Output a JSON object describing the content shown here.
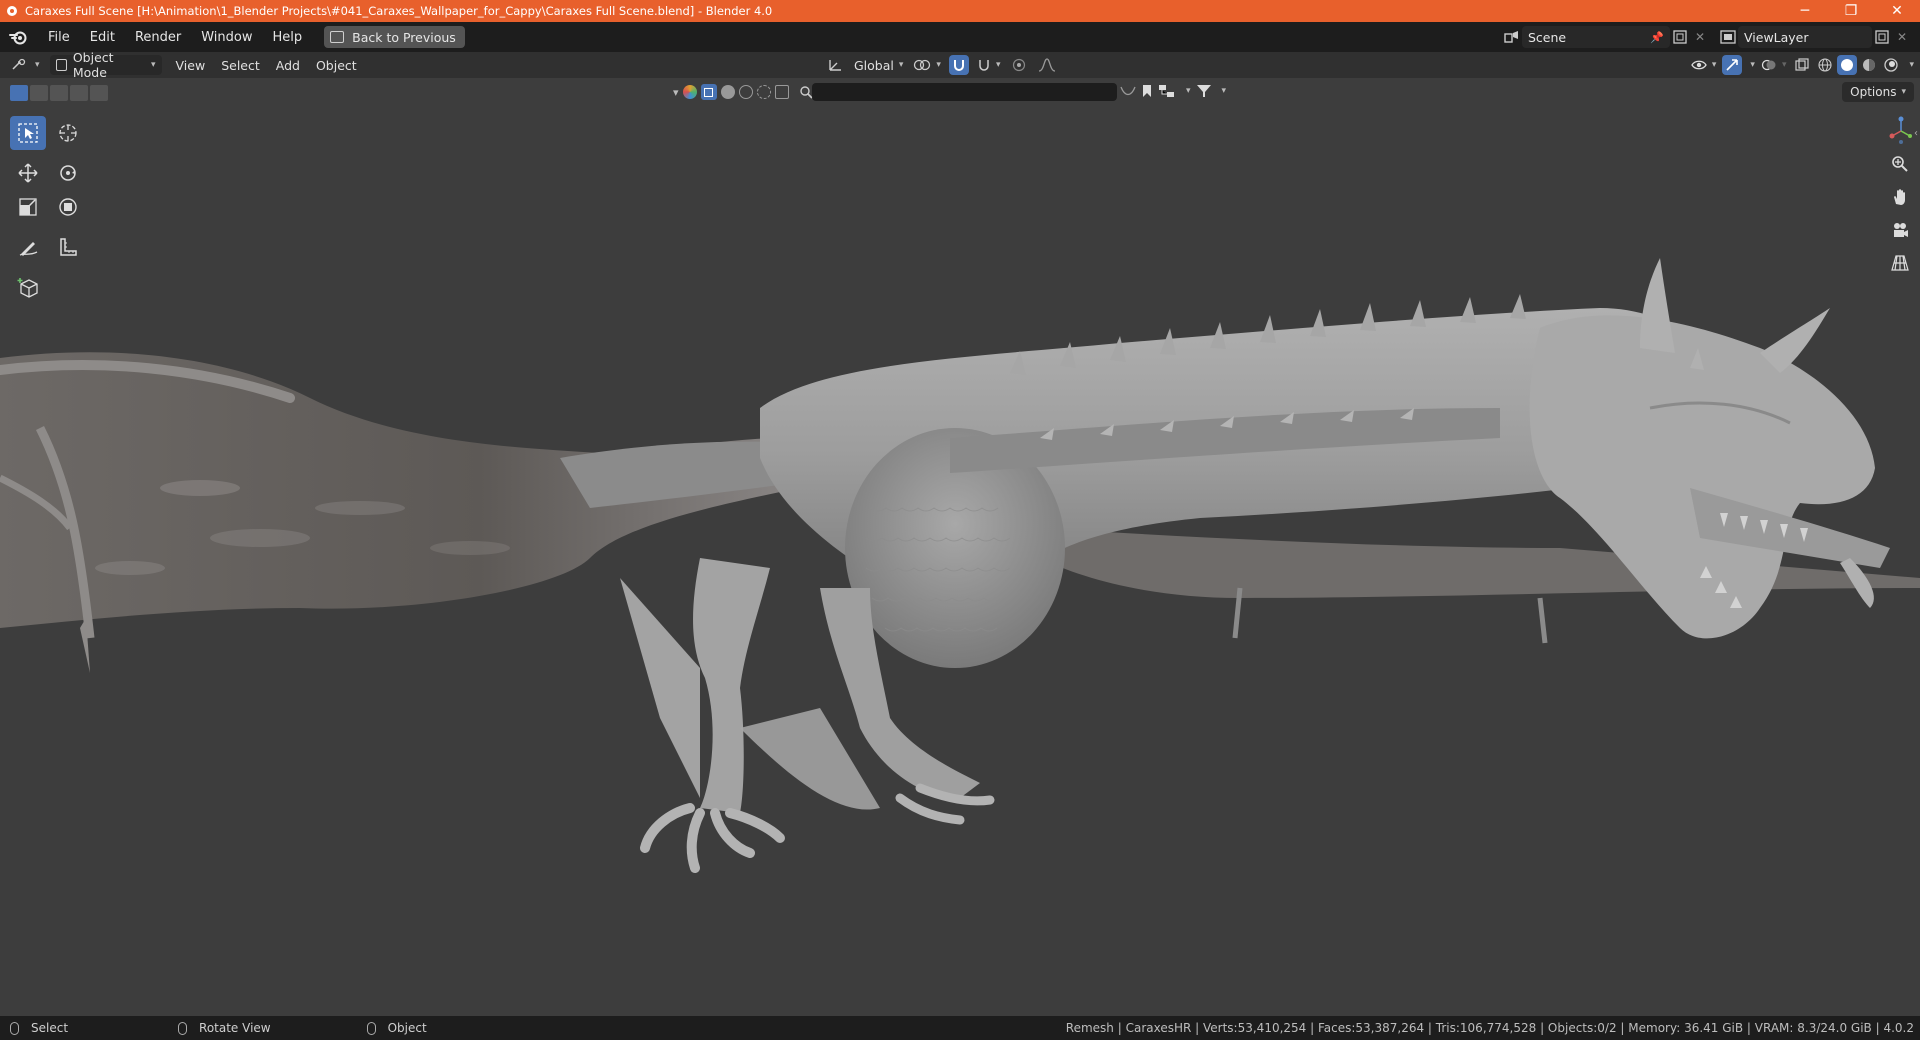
{
  "window": {
    "title": "Caraxes Full Scene [H:\\Animation\\1_Blender Projects\\#041_Caraxes_Wallpaper_for_Cappy\\Caraxes Full Scene.blend] - Blender 4.0",
    "minimize": "─",
    "restore": "❐",
    "close": "✕"
  },
  "menubar": {
    "items": [
      "File",
      "Edit",
      "Render",
      "Window",
      "Help"
    ],
    "back_button": "Back to Previous",
    "scene": "Scene",
    "view_layer": "ViewLayer"
  },
  "header": {
    "mode": "Object Mode",
    "menus": [
      "View",
      "Select",
      "Add",
      "Object"
    ],
    "transform_orientation": "Global"
  },
  "tool_header": {
    "options": "Options"
  },
  "statusbar": {
    "left": [
      "Select",
      "Rotate View",
      "Object"
    ],
    "stats": "Remesh | CaraxesHR | Verts:53,410,254 | Faces:53,387,264 | Tris:106,774,528 | Objects:0/2 | Memory: 36.41 GiB | VRAM: 8.3/24.0 GiB | 4.0.2"
  },
  "colors": {
    "title_bar": "#e8602c",
    "accent": "#4772b3",
    "viewport_bg": "#3d3d3d",
    "model": "#9a9a9a"
  }
}
